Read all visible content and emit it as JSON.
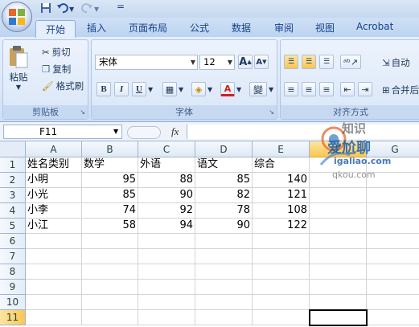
{
  "app": {
    "accent": "#c4d8f0"
  },
  "qat": {
    "save_icon": "save-icon",
    "undo_icon": "undo-icon",
    "redo_icon": "redo-icon",
    "customize_label": "="
  },
  "tabs": [
    {
      "label": "开始"
    },
    {
      "label": "插入"
    },
    {
      "label": "页面布局"
    },
    {
      "label": "公式"
    },
    {
      "label": "数据"
    },
    {
      "label": "审阅"
    },
    {
      "label": "视图"
    },
    {
      "label": "Acrobat"
    }
  ],
  "clipboard": {
    "paste_label": "粘贴",
    "cut_label": "剪切",
    "copy_label": "复制",
    "format_painter_label": "格式刷",
    "group_label": "剪贴板"
  },
  "font": {
    "name": "宋体",
    "size": "12",
    "grow_label": "A",
    "shrink_label": "A",
    "bold_label": "B",
    "italic_label": "I",
    "underline_label": "U",
    "font_color_label": "A",
    "phonetic_label": "變",
    "group_label": "字体"
  },
  "alignment": {
    "wrap_label": "自动",
    "merge_label": "合并后",
    "group_label": "对齐方式"
  },
  "formula_bar": {
    "cell_ref": "F11",
    "fx_label": "fx",
    "value": ""
  },
  "sheet": {
    "columns": [
      "A",
      "B",
      "C",
      "D",
      "E",
      "F",
      "G"
    ],
    "rows": [
      "1",
      "2",
      "3",
      "4",
      "5",
      "6",
      "7",
      "8",
      "9",
      "10",
      "11"
    ],
    "selected_column": "F",
    "selected_row": "11",
    "cells": [
      [
        "姓名类别",
        "数学",
        "外语",
        "语文",
        "综合"
      ],
      [
        "小明",
        "95",
        "88",
        "85",
        "140"
      ],
      [
        "小光",
        "85",
        "90",
        "82",
        "121"
      ],
      [
        "小李",
        "74",
        "92",
        "78",
        "108"
      ],
      [
        "小江",
        "58",
        "94",
        "90",
        "122"
      ]
    ]
  },
  "watermark": {
    "brand": "爱尬聊",
    "domain": "igaliao.com",
    "sub": "qkou.com"
  }
}
